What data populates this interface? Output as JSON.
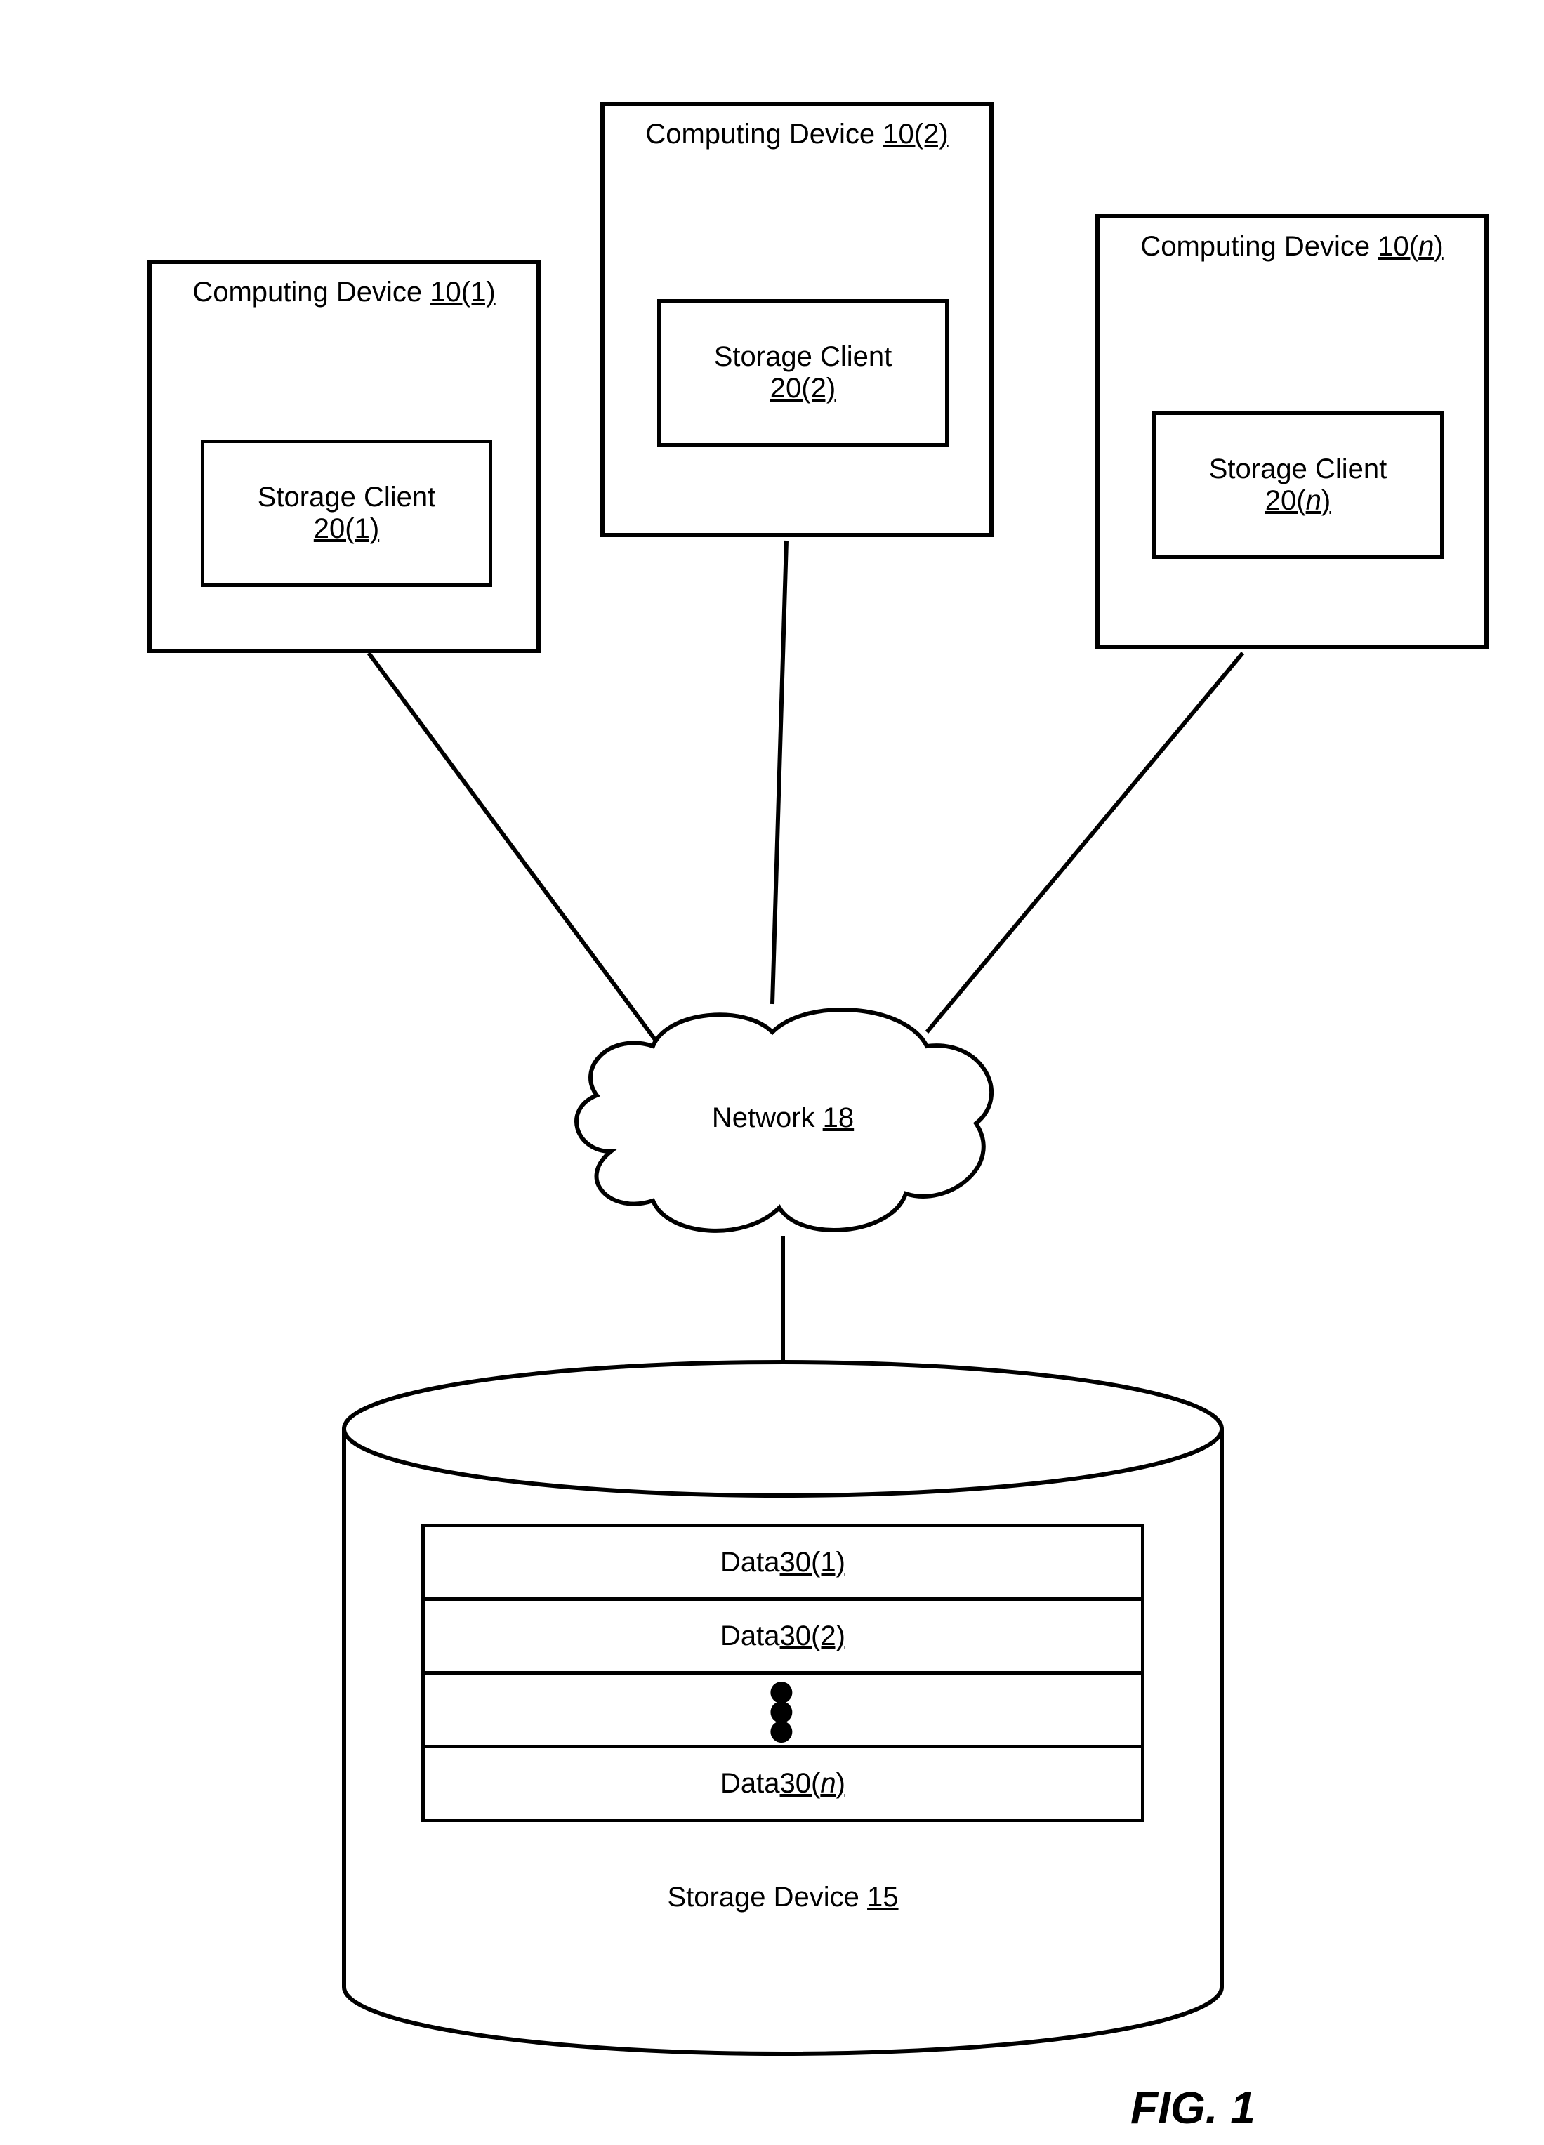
{
  "devices": [
    {
      "title_prefix": "Computing Device ",
      "title_ref": "10(1)",
      "client_label": "Storage Client",
      "client_ref": "20(1)"
    },
    {
      "title_prefix": "Computing Device ",
      "title_ref": "10(2)",
      "client_label": "Storage Client",
      "client_ref": "20(2)"
    },
    {
      "title_prefix": "Computing Device ",
      "title_ref": "10(n)",
      "client_label": "Storage Client",
      "client_ref": "20(n)",
      "ref_italic_index": 3
    }
  ],
  "network": {
    "label_prefix": "Network ",
    "ref": "18"
  },
  "storage": {
    "label_prefix": "Storage Device ",
    "ref": "15",
    "data_rows": [
      {
        "prefix": "Data ",
        "ref": "30(1)"
      },
      {
        "prefix": "Data ",
        "ref": "30(2)"
      },
      {
        "prefix": "Data ",
        "ref": "30(n)",
        "ref_italic_index": 3
      }
    ]
  },
  "figure_label": "FIG. 1"
}
